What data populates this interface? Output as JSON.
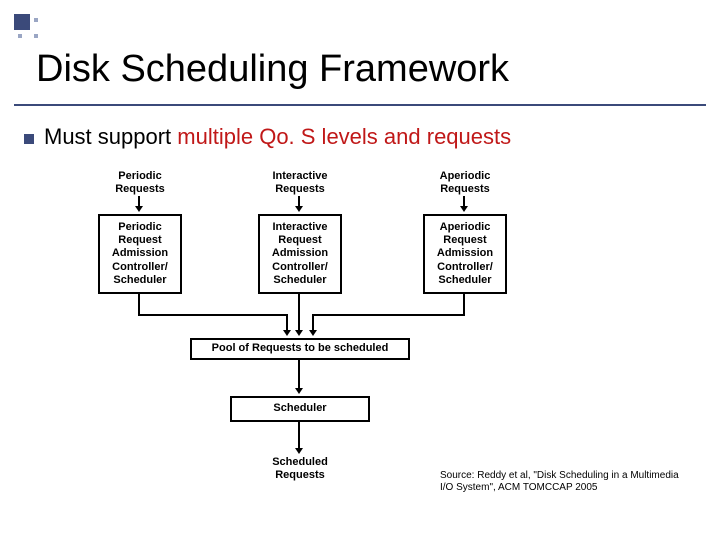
{
  "title": "Disk Scheduling Framework",
  "bullet": {
    "plain": "Must support ",
    "highlight": "multiple Qo. S levels and requests"
  },
  "diagram": {
    "topLabels": {
      "periodic": "Periodic\nRequests",
      "interactive": "Interactive\nRequests",
      "aperiodic": "Aperiodic\nRequests"
    },
    "boxes": {
      "periodic": "Periodic\nRequest\nAdmission\nController/\nScheduler",
      "interactive": "Interactive\nRequest\nAdmission\nController/\nScheduler",
      "aperiodic": "Aperiodic\nRequest\nAdmission\nController/\nScheduler",
      "pool": "Pool of Requests to be scheduled",
      "scheduler": "Scheduler"
    },
    "bottomLabel": "Scheduled\nRequests"
  },
  "source": "Source: Reddy et al, \"Disk Scheduling in a Multimedia I/O System\",  ACM TOMCCAP 2005"
}
